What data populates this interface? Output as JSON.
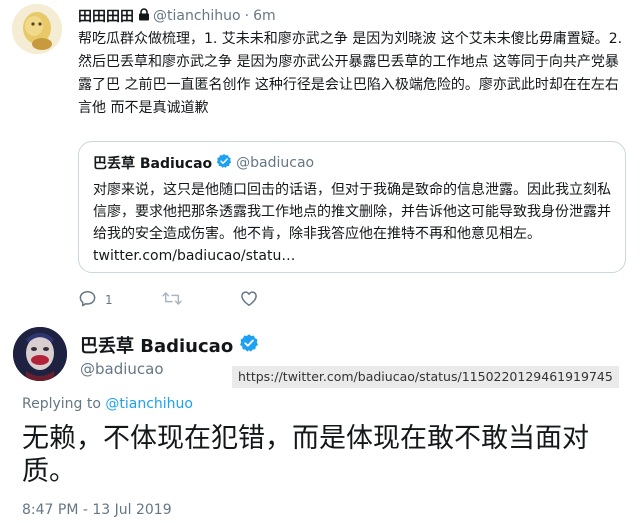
{
  "parent_tweet": {
    "display_name": "田田田田",
    "handle": "@tianchihuo",
    "separator": "·",
    "time": "6m",
    "text": "帮吃瓜群众做梳理，1. 艾未未和廖亦武之争 是因为刘晓波 这个艾未未傻比毋庸置疑。2. 然后巴丢草和廖亦武之争 是因为廖亦武公开暴露巴丢草的工作地点 这等同于向共产党暴露了巴 之前巴一直匿名创作 这种行径是会让巴陷入极端危险的。廖亦武此时却在在左右言他 而不是真诚道歉",
    "quote": {
      "display_name": "巴丢草 Badiucao",
      "handle": "@badiucao",
      "text": "对廖来说，这只是他随口回击的话语，但对于我确是致命的信息泄露。因此我立刻私信廖，要求他把那条透露我工作地点的推文删除，并告诉他这可能导致我身份泄露并给我的安全造成伤害。他不肯，除非我答应他在推特不再和他意见相左。",
      "link": "twitter.com/badiucao/statu…"
    },
    "actions": {
      "reply_count": "1"
    }
  },
  "focused_tweet": {
    "display_name": "巴丢草 Badiucao",
    "handle": "@badiucao",
    "url_overlay": "https://twitter.com/badiucao/status/1150220129461919745",
    "replying_prefix": "Replying to",
    "replying_to": "@tianchihuo",
    "text": "无赖，不体现在犯错，而是体现在敢不敢当面对质。",
    "timestamp": "8:47 PM - 13 Jul 2019"
  },
  "colors": {
    "accent": "#1da1f2",
    "muted": "#657786",
    "border": "#ccd6dd",
    "text": "#14171a"
  },
  "icons": [
    "lock-icon",
    "verified-badge-icon",
    "reply-icon",
    "retweet-icon",
    "like-icon"
  ]
}
